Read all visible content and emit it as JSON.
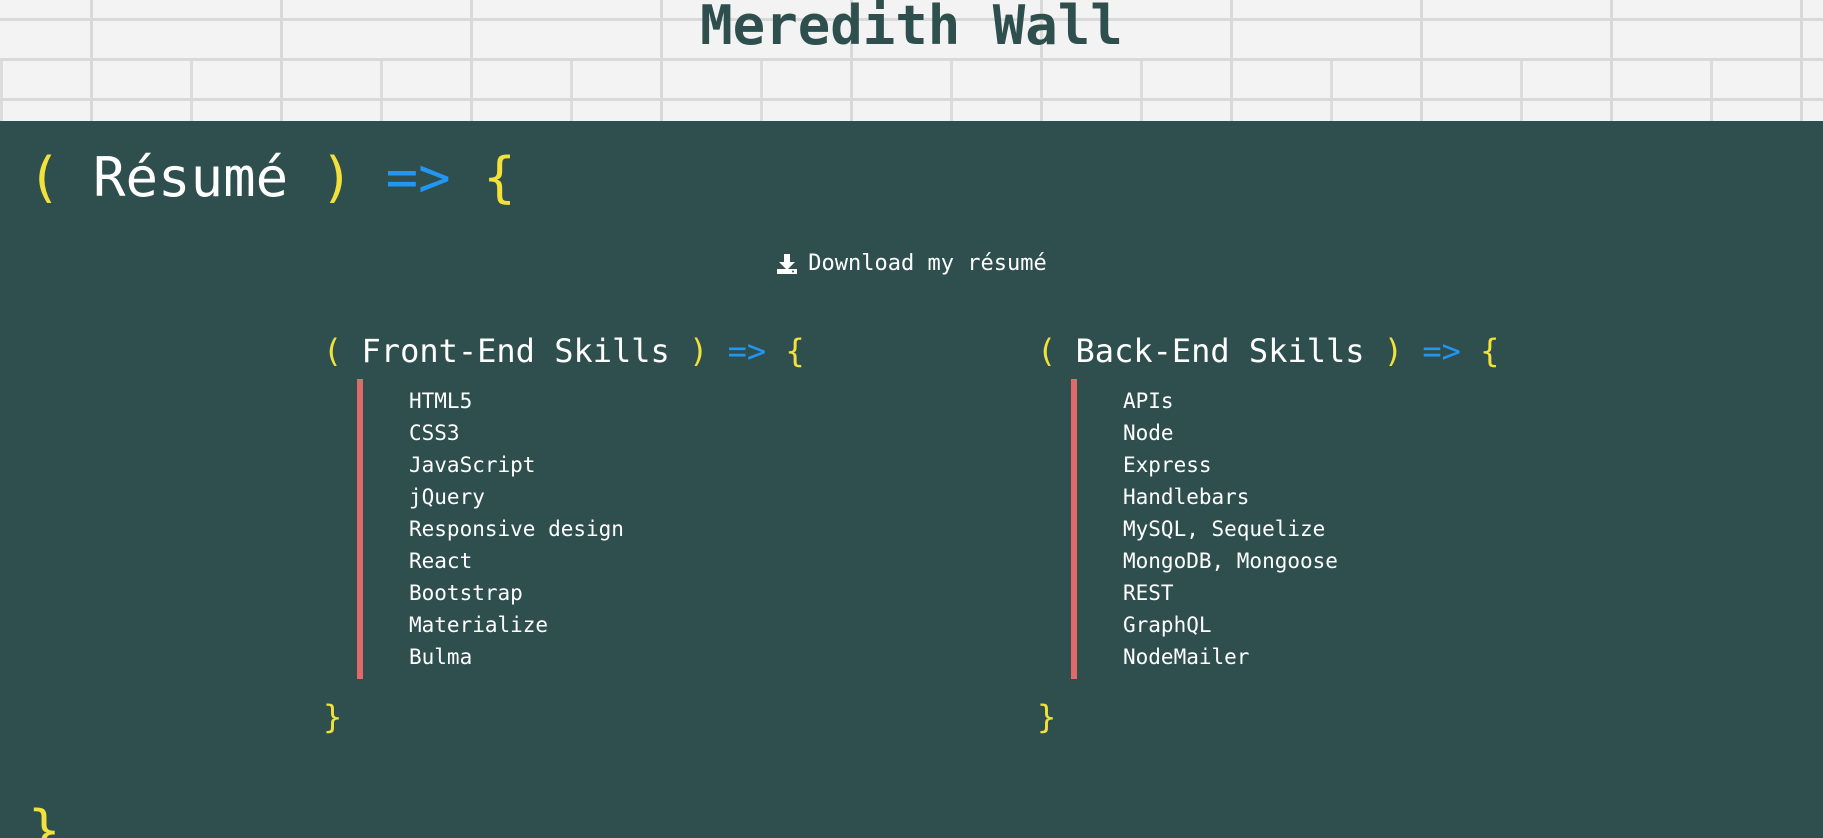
{
  "header": {
    "title": "Meredith Wall"
  },
  "resume_section": {
    "open_paren": "(",
    "title": "Résumé",
    "close_paren": ")",
    "arrow": "=>",
    "open_brace": "{",
    "close_brace": "}"
  },
  "download": {
    "label": "Download my résumé",
    "icon": "download-icon"
  },
  "front_end": {
    "open_paren": "(",
    "title": "Front-End Skills",
    "close_paren": ")",
    "arrow": "=>",
    "open_brace": "{",
    "close_brace": "}",
    "skills": [
      "HTML5",
      "CSS3",
      "JavaScript",
      "jQuery",
      "Responsive design",
      "React",
      "Bootstrap",
      "Materialize",
      "Bulma"
    ]
  },
  "back_end": {
    "open_paren": "(",
    "title": "Back-End Skills",
    "close_paren": ")",
    "arrow": "=>",
    "open_brace": "{",
    "close_brace": "}",
    "skills": [
      "APIs",
      "Node",
      "Express",
      "Handlebars",
      "MySQL, Sequelize",
      "MongoDB, Mongoose",
      "REST",
      "GraphQL",
      "NodeMailer"
    ]
  },
  "colors": {
    "background": "#2f4f4f",
    "accent_yellow": "#f2e13a",
    "accent_blue": "#2196f3",
    "list_border": "#e06a6a",
    "header_bg": "#f3f3f3"
  }
}
